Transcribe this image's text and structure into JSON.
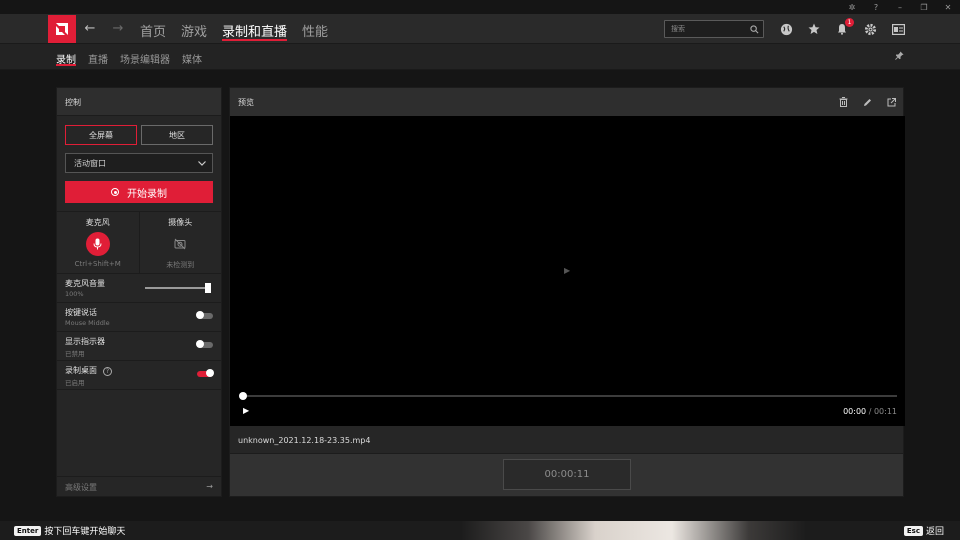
{
  "colors": {
    "accent": "#e01e37",
    "background": "#151515",
    "panel": "#262626"
  },
  "window_controls": [
    "bug-icon",
    "help-icon",
    "minimize-icon",
    "restore-icon",
    "close-icon"
  ],
  "nav": {
    "tabs": [
      {
        "label": "首页",
        "active": false
      },
      {
        "label": "游戏",
        "active": false
      },
      {
        "label": "录制和直播",
        "active": true
      },
      {
        "label": "性能",
        "active": false
      }
    ],
    "search_placeholder": "搜索",
    "notification_count": "1"
  },
  "sub_nav": {
    "tabs": [
      {
        "label": "录制",
        "active": true
      },
      {
        "label": "直播",
        "active": false
      },
      {
        "label": "场景编辑器",
        "active": false
      },
      {
        "label": "媒体",
        "active": false
      }
    ]
  },
  "control": {
    "title": "控制",
    "mode_fullscreen": "全屏幕",
    "mode_region": "地区",
    "dropdown_value": "活动窗口",
    "record_label": "开始录制",
    "mic_title": "麦克风",
    "mic_hotkey": "Ctrl+Shift+M",
    "camera_title": "摄像头",
    "camera_status": "未检测到",
    "mic_volume_label": "麦克风音量",
    "mic_volume_value": "100%",
    "mic_volume_level": 1.0,
    "push_to_talk_label": "按键说话",
    "push_to_talk_sub": "Mouse Middle",
    "push_to_talk_on": false,
    "show_indicator_label": "显示指示器",
    "show_indicator_sub": "已禁用",
    "show_indicator_on": false,
    "record_desktop_label": "录制桌面",
    "record_desktop_sub": "已启用",
    "record_desktop_on": true,
    "advanced_label": "高级设置"
  },
  "preview": {
    "title": "预览",
    "current_time": "00:00",
    "separator": "/",
    "total_time": "00:11",
    "progress": 0,
    "filename": "unknown_2021.12.18-23.35.mp4",
    "timer": "00:00:11"
  },
  "footer": {
    "enter_key": "Enter",
    "enter_hint": "按下回车键开始聊天",
    "esc_key": "Esc",
    "esc_hint": "返回"
  }
}
